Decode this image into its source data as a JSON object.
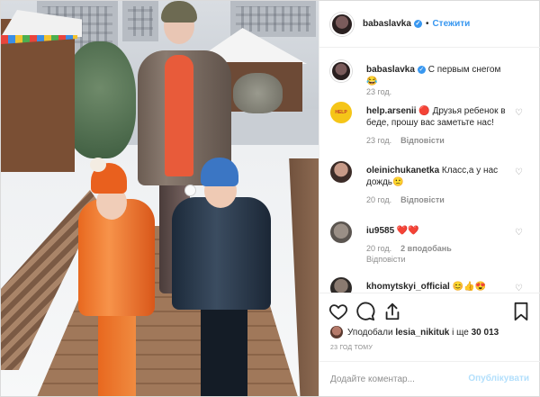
{
  "header": {
    "username": "babaslavka",
    "follow_label": "Стежити",
    "dot": "•"
  },
  "caption": {
    "username": "babaslavka",
    "text": "С первым снегом 😂",
    "time": "23 год."
  },
  "comments": [
    {
      "username": "help.arsenii",
      "avatar_text": "HELP",
      "text": "🔴 Друзья ребенок в беде, прошу вас заметьте нас!",
      "time": "23 год.",
      "reply_label": "Відповісти",
      "likes": ""
    },
    {
      "username": "oleinichukanetka",
      "text": "Класс,а у нас дождь🙁",
      "time": "20 год.",
      "reply_label": "Відповісти",
      "likes": ""
    },
    {
      "username": "iu9585",
      "text": "❤️❤️",
      "time": "20 год.",
      "likes": "2 вподобань",
      "reply_label": "Відповісти"
    },
    {
      "username": "khomytskyi_official",
      "text": "😊👍😍",
      "time": "",
      "reply_label": "",
      "likes": ""
    }
  ],
  "likes_line": {
    "prefix": "Уподобали",
    "user": "lesia_nikituk",
    "middle": "і ще",
    "count": "30 013"
  },
  "timestamp": "23 ГОД ТОМУ",
  "add_comment": {
    "placeholder": "Додайте коментар...",
    "publish_label": "Опублікувати"
  },
  "colors": {
    "accent": "#3897f0",
    "publish_disabled": "#b2dffc",
    "muted": "#8e8e8e",
    "text": "#262626"
  }
}
